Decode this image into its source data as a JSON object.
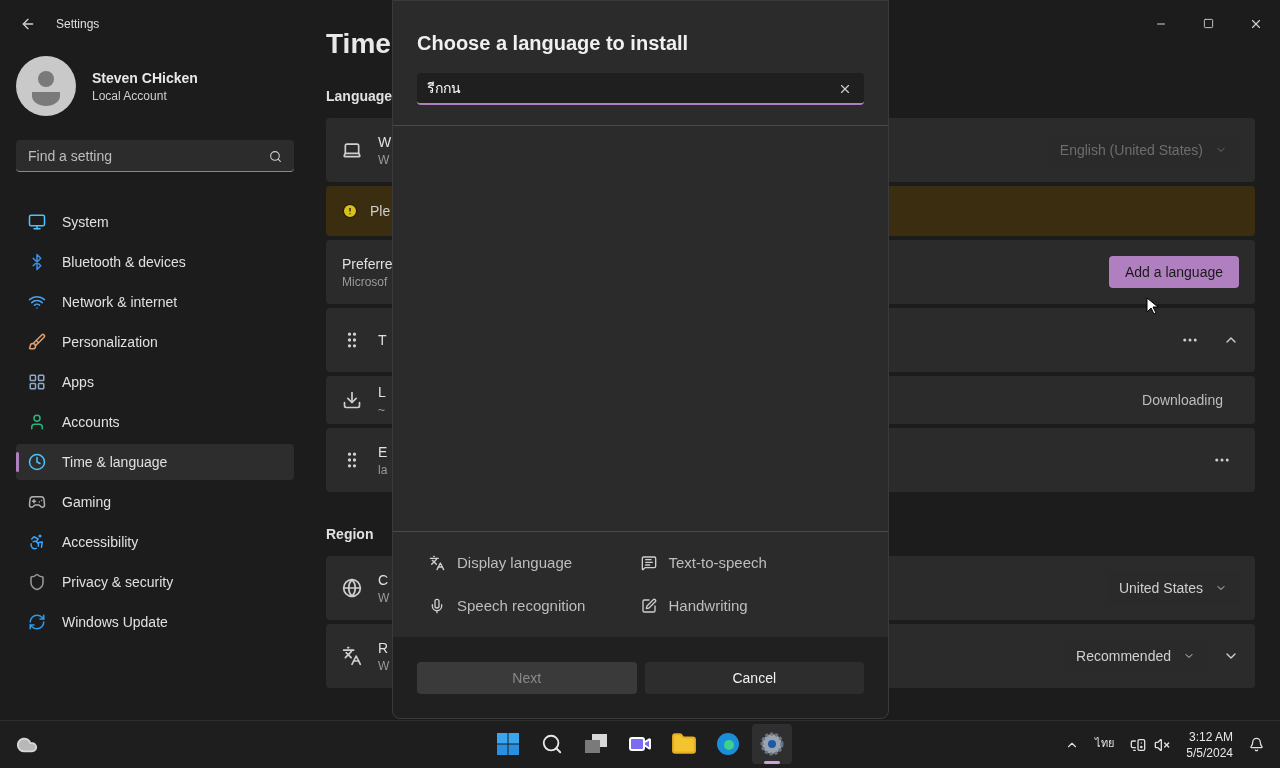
{
  "window": {
    "title": "Settings"
  },
  "account": {
    "name": "Steven CHicken",
    "type": "Local Account"
  },
  "search": {
    "placeholder": "Find a setting"
  },
  "sidebar": {
    "items": [
      {
        "label": "System",
        "selected": false
      },
      {
        "label": "Bluetooth & devices",
        "selected": false
      },
      {
        "label": "Network & internet",
        "selected": false
      },
      {
        "label": "Personalization",
        "selected": false
      },
      {
        "label": "Apps",
        "selected": false
      },
      {
        "label": "Accounts",
        "selected": false
      },
      {
        "label": "Time & language",
        "selected": true
      },
      {
        "label": "Gaming",
        "selected": false
      },
      {
        "label": "Accessibility",
        "selected": false
      },
      {
        "label": "Privacy & security",
        "selected": false
      },
      {
        "label": "Windows Update",
        "selected": false
      }
    ]
  },
  "page": {
    "title": "Time",
    "sections": [
      {
        "heading": "Language",
        "rows": [
          {
            "kind": "setting",
            "title": "W",
            "subtitle": "W",
            "control": {
              "kind": "dropdown",
              "value": "English (United States)",
              "disabled": true
            }
          },
          {
            "kind": "warning",
            "title": "Ple"
          },
          {
            "kind": "setting",
            "title": "Preferre",
            "subtitle": "Microsof",
            "control": {
              "kind": "button",
              "label": "Add a language"
            }
          },
          {
            "kind": "language",
            "title": "T",
            "expanded": true
          },
          {
            "kind": "sub",
            "title": "L",
            "subtitle": "~",
            "status": "Downloading"
          },
          {
            "kind": "language",
            "title": "E",
            "subtitle": "la"
          }
        ]
      },
      {
        "heading": "Region",
        "rows": [
          {
            "kind": "setting",
            "title": "C",
            "subtitle": "W",
            "control": {
              "kind": "dropdown",
              "value": "United States",
              "disabled": false
            }
          },
          {
            "kind": "setting",
            "title": "R",
            "subtitle": "W",
            "expanded": false,
            "control": {
              "kind": "dropdown",
              "value": "Recommended",
              "disabled": false
            }
          }
        ]
      }
    ]
  },
  "dialog": {
    "title": "Choose a language to install",
    "search": {
      "value": "รีกกน"
    },
    "features": [
      {
        "label": "Display language"
      },
      {
        "label": "Text-to-speech"
      },
      {
        "label": "Speech recognition"
      },
      {
        "label": "Handwriting"
      }
    ],
    "buttons": [
      {
        "label": "Next",
        "disabled": true
      },
      {
        "label": "Cancel",
        "disabled": false
      }
    ]
  },
  "taskbar": {
    "apps": [
      {
        "selected": false
      },
      {
        "selected": false
      },
      {
        "selected": false
      },
      {
        "selected": false
      },
      {
        "selected": false
      },
      {
        "selected": false
      },
      {
        "selected": true
      }
    ],
    "language": "ไทย",
    "time": "3:12 AM",
    "date": "5/5/2024"
  }
}
